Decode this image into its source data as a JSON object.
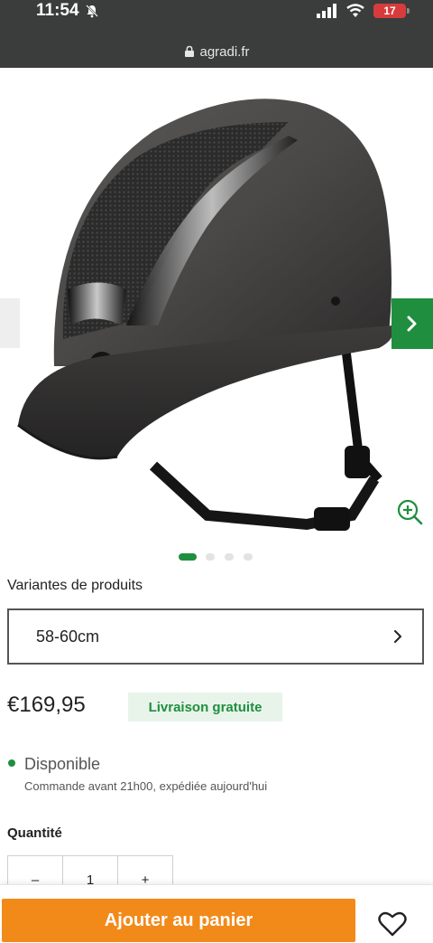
{
  "status_bar": {
    "time": "11:54",
    "battery": "17"
  },
  "browser": {
    "url": "agradi.fr"
  },
  "gallery": {
    "slide_count": 4,
    "active_slide": 1
  },
  "variants": {
    "label": "Variantes de produits",
    "selected": "58-60cm"
  },
  "pricing": {
    "price": "€169,95",
    "shipping_badge": "Livraison gratuite"
  },
  "availability": {
    "status": "Disponible",
    "detail": "Commande avant 21h00, expédiée aujourd'hui"
  },
  "quantity": {
    "label": "Quantité",
    "decrement": "–",
    "value": "1",
    "increment": "+"
  },
  "actions": {
    "add_to_cart": "Ajouter au panier"
  },
  "colors": {
    "accent_green": "#1f8f3f",
    "cta_orange": "#f28a1a",
    "status_bar_bg": "#3a3d3c"
  },
  "icons": {
    "mute": "bell-slash-icon",
    "signal": "signal-icon",
    "wifi": "wifi-icon",
    "lock": "lock-icon",
    "next": "chevron-right-icon",
    "zoom": "zoom-in-icon",
    "variant_arrow": "chevron-right-icon",
    "wishlist": "heart-icon"
  }
}
